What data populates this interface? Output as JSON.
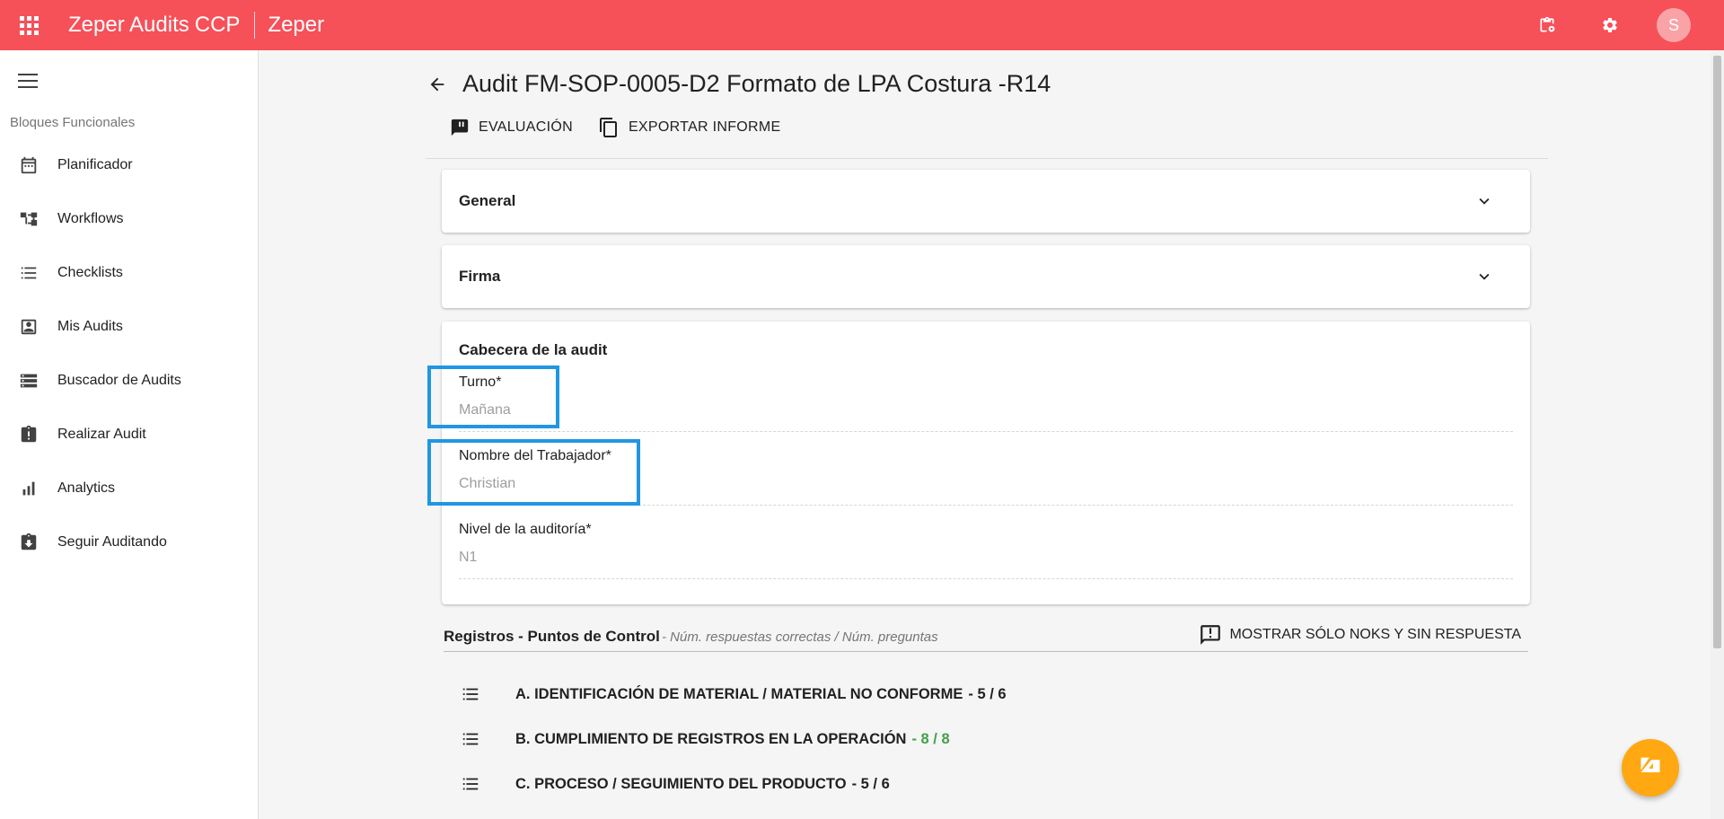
{
  "app": {
    "name": "Zeper Audits",
    "name_suffix": "CCP",
    "org": "Zeper",
    "avatar_initial": "S",
    "accent": "#f65059"
  },
  "top_actions": [
    {
      "name": "clipboard-icon"
    },
    {
      "name": "gear-icon"
    }
  ],
  "sidebar": {
    "section": "Bloques Funcionales",
    "items": [
      {
        "label": "Planificador",
        "icon": "calendar-icon"
      },
      {
        "label": "Workflows",
        "icon": "workflow-icon"
      },
      {
        "label": "Checklists",
        "icon": "checklist-icon"
      },
      {
        "label": "Mis Audits",
        "icon": "account-box-icon"
      },
      {
        "label": "Buscador de Audits",
        "icon": "storage-icon"
      },
      {
        "label": "Realizar Audit",
        "icon": "assignment-alert-icon"
      },
      {
        "label": "Analytics",
        "icon": "bar-chart-icon"
      },
      {
        "label": "Seguir Auditando",
        "icon": "assignment-return-icon"
      }
    ]
  },
  "page": {
    "title": "Audit FM-SOP-0005-D2 Formato de LPA Costura -R14"
  },
  "tabs": [
    {
      "label": "EVALUACIÓN",
      "icon": "rate-review-icon"
    },
    {
      "label": "EXPORTAR INFORME",
      "icon": "copy-icon"
    }
  ],
  "panels": {
    "general": "General",
    "firma": "Firma"
  },
  "cabecera": {
    "title": "Cabecera de la audit",
    "fields": [
      {
        "label": "Turno*",
        "value": "Mañana"
      },
      {
        "label": "Nombre del Trabajador*",
        "value": "Christian"
      },
      {
        "label": "Nivel de la auditoría*",
        "value": "N1"
      }
    ]
  },
  "registros": {
    "title": "Registros - Puntos de Control",
    "subtitle": "- Núm. respuestas correctas / Núm. preguntas",
    "filter_label": "MOSTRAR SÓLO NOKS Y SIN RESPUESTA",
    "items": [
      {
        "text": "A. IDENTIFICACIÓN DE MATERIAL / MATERIAL NO CONFORME",
        "count": "- 5 / 6",
        "color": "#212121"
      },
      {
        "text": "B. CUMPLIMIENTO DE REGISTROS EN LA OPERACIÓN",
        "count": "- 8 / 8",
        "color": "#43a047"
      },
      {
        "text": "C. PROCESO / SEGUIMIENTO DEL PRODUCTO",
        "count": "- 5 / 6",
        "color": "#212121"
      }
    ]
  }
}
